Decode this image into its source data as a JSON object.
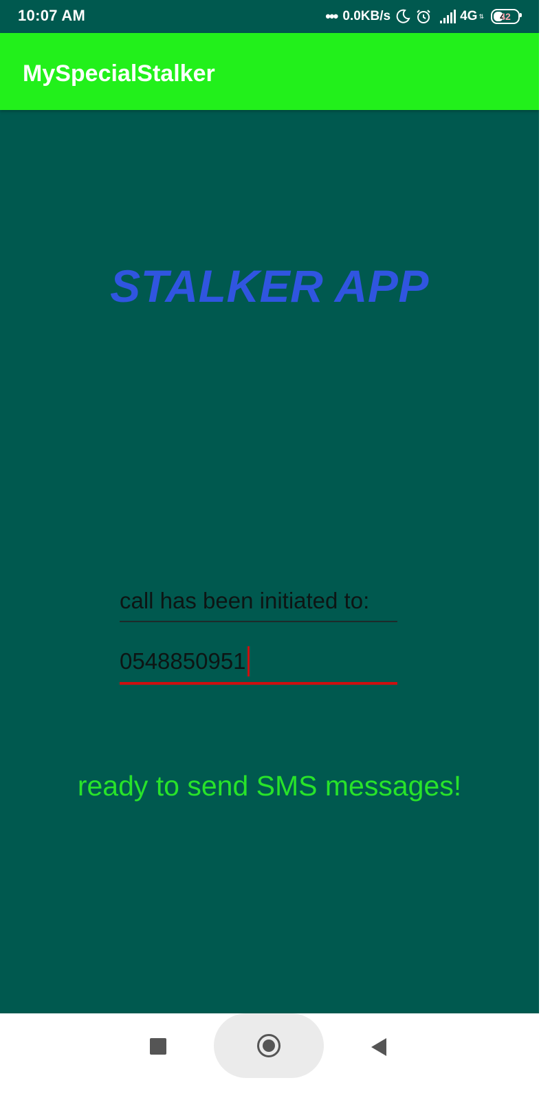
{
  "status_bar": {
    "time": "10:07 AM",
    "dots": "•••",
    "network_speed": "0.0KB/s",
    "network_type": "4G",
    "battery_level": "42",
    "icons": [
      "moon-icon",
      "alarm-icon",
      "signal-icon",
      "battery-icon"
    ]
  },
  "app_bar": {
    "title": "MySpecialStalker",
    "color": "#22f01b"
  },
  "main": {
    "headline": "STALKER APP",
    "headline_color": "#3055e0",
    "label_field": "call has been initiated to:",
    "phone_field": "0548850951",
    "sms_status": "ready to send SMS messages!",
    "sms_status_color": "#28e32a",
    "background_color": "#00594f"
  },
  "nav_bar": {
    "buttons": [
      "recent-apps",
      "home",
      "back"
    ]
  }
}
